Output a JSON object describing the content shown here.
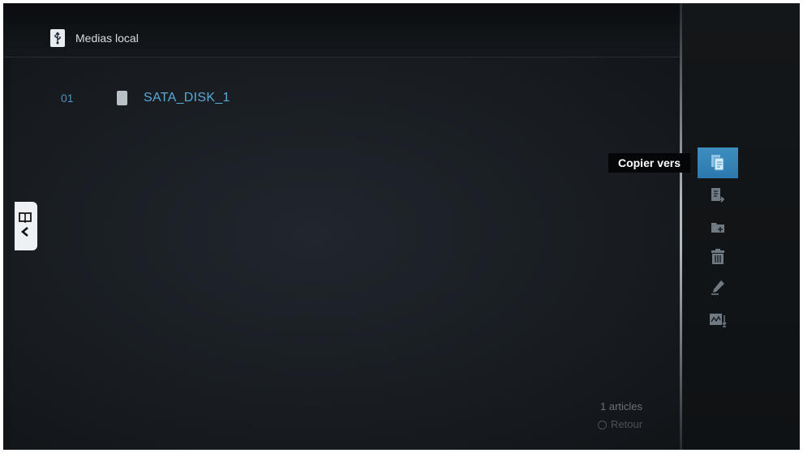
{
  "header": {
    "icon": "usb-icon",
    "title": "Medias local"
  },
  "list": {
    "items": [
      {
        "index": "01",
        "icon": "disk-icon",
        "label": "SATA_DISK_1"
      }
    ]
  },
  "side_tab": {
    "icons": [
      "book-icon",
      "chevron-left-icon"
    ]
  },
  "action_menu": {
    "tooltip": "Copier vers",
    "items": [
      {
        "icon": "copy-to-icon",
        "active": true
      },
      {
        "icon": "move-to-icon",
        "active": false
      },
      {
        "icon": "new-folder-icon",
        "active": false
      },
      {
        "icon": "trash-icon",
        "active": false
      },
      {
        "icon": "rename-icon",
        "active": false
      },
      {
        "icon": "sort-icon",
        "active": false
      }
    ]
  },
  "footer": {
    "count": "1 articles",
    "back": "Retour"
  },
  "colors": {
    "accent": "#3e8ec1",
    "list_text": "#5aa8d6",
    "background": "#15191d"
  }
}
